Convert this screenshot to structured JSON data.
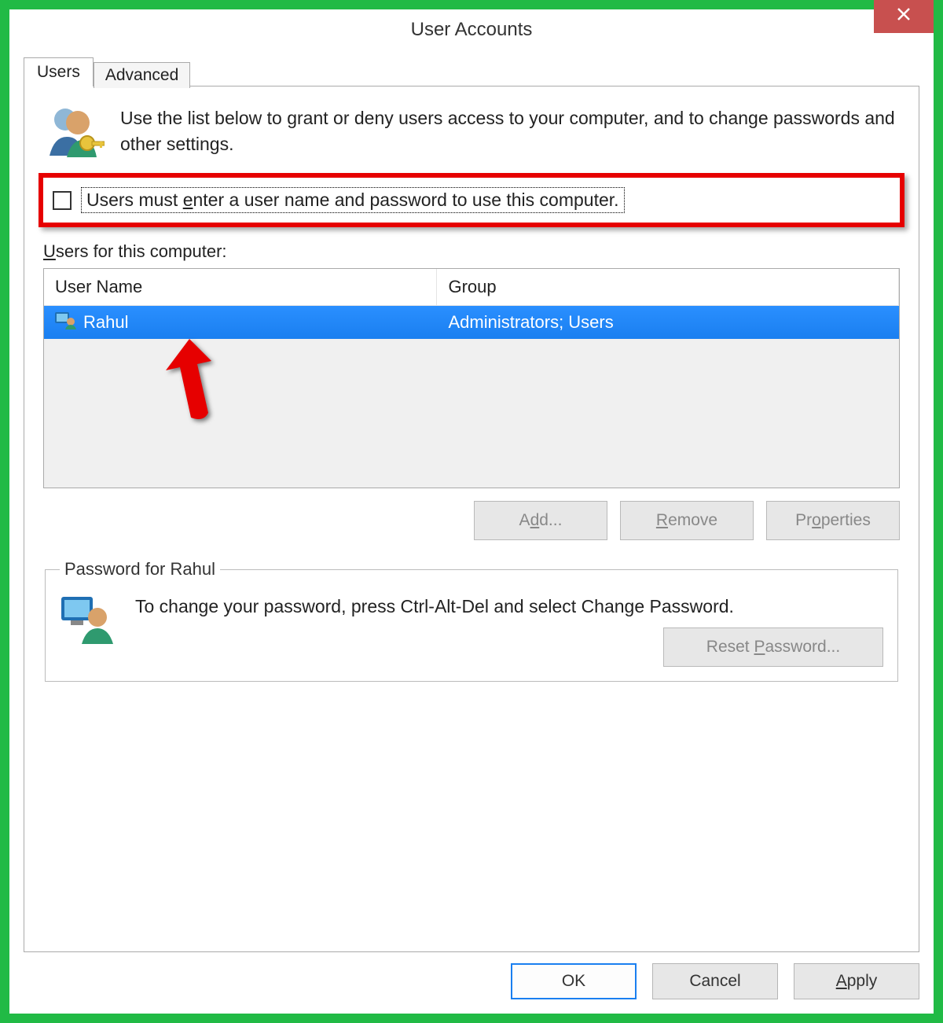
{
  "window": {
    "title": "User Accounts"
  },
  "tabs": {
    "active": "Users",
    "inactive": "Advanced"
  },
  "intro": "Use the list below to grant or deny users access to your computer, and to change passwords and other settings.",
  "checkbox": {
    "label_pre": "Users must ",
    "label_u": "e",
    "label_post": "nter a user name and password to use this computer."
  },
  "userslist": {
    "label_pre": "U",
    "label_post": "sers for this computer:",
    "headers": {
      "name": "User Name",
      "group": "Group"
    },
    "rows": [
      {
        "name": "Rahul",
        "group": "Administrators; Users"
      }
    ]
  },
  "buttons": {
    "add": "Add...",
    "remove": "Remove",
    "properties": "Properties"
  },
  "passwordGroup": {
    "legend": "Password for Rahul",
    "text": "To change your password, press Ctrl-Alt-Del and select Change Password.",
    "reset": "Reset Password..."
  },
  "footer": {
    "ok": "OK",
    "cancel": "Cancel",
    "apply": "Apply"
  }
}
